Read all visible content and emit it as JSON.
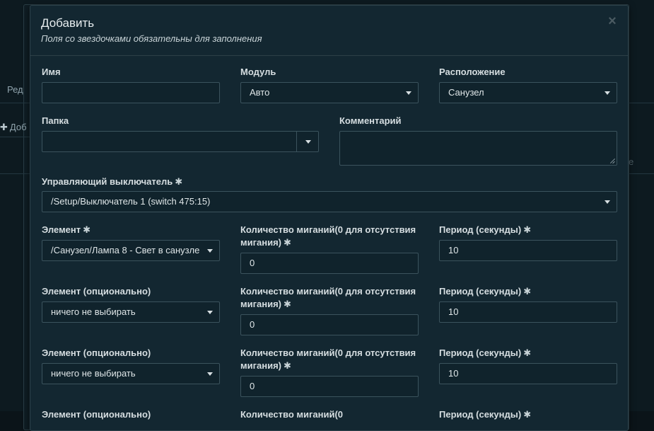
{
  "background": {
    "tab_partial": "Ред",
    "add_partial": "Доб",
    "col_partial": "е"
  },
  "modal": {
    "title": "Добавить",
    "subtitle": "Поля со звездочками обязательны для заполнения",
    "close_icon": "×"
  },
  "form": {
    "name": {
      "label": "Имя",
      "value": ""
    },
    "module": {
      "label": "Модуль",
      "value": "Авто"
    },
    "location": {
      "label": "Расположение",
      "value": "Санузел"
    },
    "folder": {
      "label": "Папка",
      "value": ""
    },
    "comment": {
      "label": "Комментарий",
      "value": ""
    },
    "control_switch": {
      "label": "Управляющий выключатель",
      "value": "/Setup/Выключатель 1 (switch 475:15)"
    },
    "rows": [
      {
        "element_label": "Элемент",
        "element_required": true,
        "element_value": "/Санузел/Лампа 8 - Свет в санузле",
        "blinks_label": "Количество миганий(0 для отсутствия мигания)",
        "blinks_value": "0",
        "period_label": "Период (секунды)",
        "period_value": "10"
      },
      {
        "element_label": "Элемент (опционально)",
        "element_required": false,
        "element_value": "ничего не выбирать",
        "blinks_label": "Количество миганий(0 для отсутствия мигания)",
        "blinks_value": "0",
        "period_label": "Период (секунды)",
        "period_value": "10"
      },
      {
        "element_label": "Элемент (опционально)",
        "element_required": false,
        "element_value": "ничего не выбирать",
        "blinks_label": "Количество миганий(0 для отсутствия мигания)",
        "blinks_value": "0",
        "period_label": "Период (секунды)",
        "period_value": "10"
      },
      {
        "element_label": "Элемент (опционально)",
        "blinks_label": "Количество миганий(0",
        "period_label": "Период (секунды)"
      }
    ]
  },
  "colors": {
    "modal_bg": "#132731",
    "field_bg": "#10232c",
    "field_border": "#3b535d"
  }
}
